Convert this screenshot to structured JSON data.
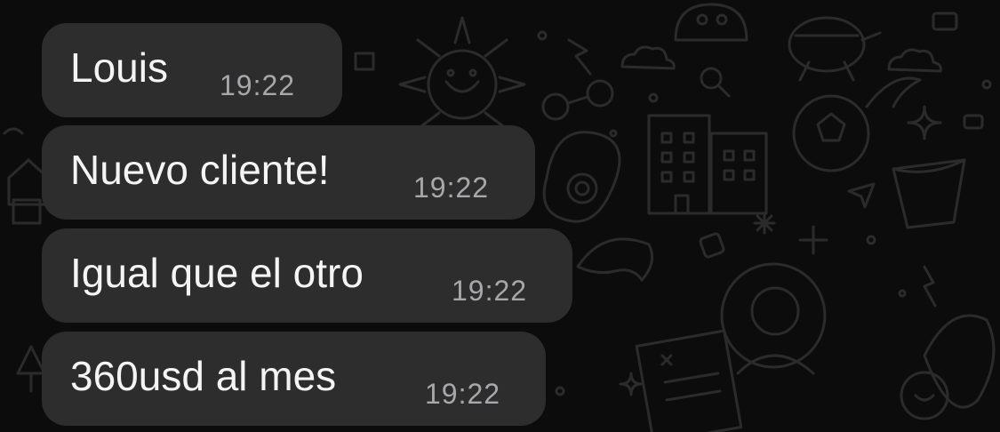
{
  "conversation": {
    "messages": [
      {
        "text": "Louis",
        "time": "19:22"
      },
      {
        "text": "Nuevo cliente!",
        "time": "19:22"
      },
      {
        "text": "Igual que el otro",
        "time": "19:22"
      },
      {
        "text": "360usd al mes",
        "time": "19:22"
      }
    ]
  },
  "theme": {
    "background": "#0c0c0c",
    "bubble": "#2d2d2e",
    "text": "#f4f4f4",
    "timestamp": "#a8a8aa",
    "doodle": "#2a2a2a"
  }
}
